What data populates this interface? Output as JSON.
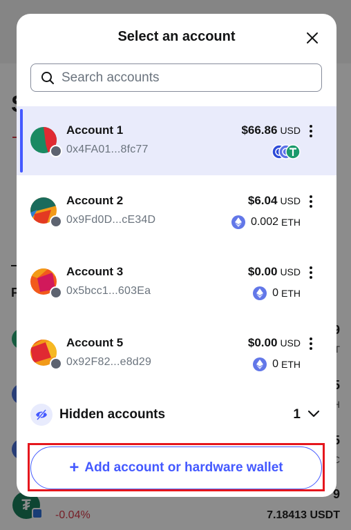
{
  "modal": {
    "title": "Select an account",
    "search_placeholder": "Search accounts"
  },
  "accounts": [
    {
      "name": "Account 1",
      "address": "0x4FA01...8fc77",
      "balance": "$66.86",
      "currency": "USD",
      "sub_amount": "",
      "sub_currency": "",
      "selected": true
    },
    {
      "name": "Account 2",
      "address": "0x9Fd0D...cE34D",
      "balance": "$6.04",
      "currency": "USD",
      "sub_amount": "0.002",
      "sub_currency": "ETH",
      "selected": false
    },
    {
      "name": "Account 3",
      "address": "0x5bcc1...603Ea",
      "balance": "$0.00",
      "currency": "USD",
      "sub_amount": "0",
      "sub_currency": "ETH",
      "selected": false
    },
    {
      "name": "Account 5",
      "address": "0x92F82...e8d29",
      "balance": "$0.00",
      "currency": "USD",
      "sub_amount": "0",
      "sub_currency": "ETH",
      "selected": false
    }
  ],
  "hidden": {
    "label": "Hidden accounts",
    "count": "1"
  },
  "add_button": {
    "label": "Add account or hardware wallet"
  },
  "background": {
    "percent": "-0.04%",
    "balance": "7.18413 USDT"
  },
  "colors": {
    "accent": "#4459ff",
    "selected_bg": "#e9ebfb",
    "highlight": "#e5161d",
    "negative": "#d73847"
  },
  "icons": {
    "search": "search-icon",
    "close": "close-icon",
    "menu": "more-vertical-icon",
    "hidden": "eye-slash-icon",
    "chevron": "chevron-down-icon",
    "eth": "eth-icon"
  }
}
